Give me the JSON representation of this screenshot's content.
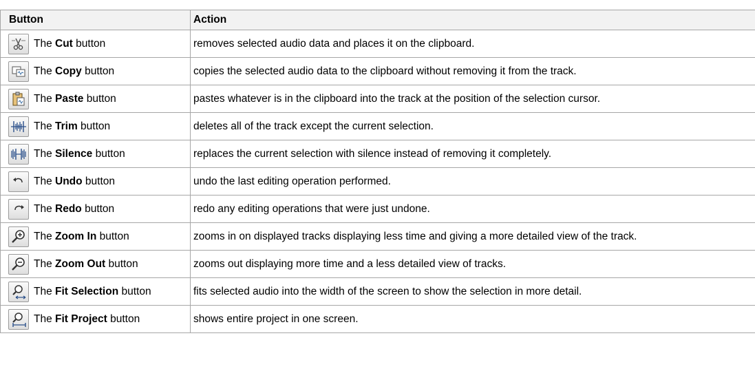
{
  "headers": {
    "button": "Button",
    "action": "Action"
  },
  "rows": [
    {
      "icon": "cut-icon",
      "prefix": "The ",
      "name": "Cut",
      "suffix": " button",
      "action": "removes selected audio data and places it on the clipboard."
    },
    {
      "icon": "copy-icon",
      "prefix": "The ",
      "name": "Copy",
      "suffix": " button",
      "action": "copies the selected audio data to the clipboard without removing it from the track."
    },
    {
      "icon": "paste-icon",
      "prefix": "The ",
      "name": "Paste",
      "suffix": " button",
      "action": "pastes whatever is in the clipboard into the track at the position of the selection cursor."
    },
    {
      "icon": "trim-icon",
      "prefix": "The ",
      "name": "Trim",
      "suffix": " button",
      "action": "deletes all of the track except the current selection."
    },
    {
      "icon": "silence-icon",
      "prefix": "The ",
      "name": "Silence",
      "suffix": " button",
      "action": "replaces the current selection with silence instead of removing it completely."
    },
    {
      "icon": "undo-icon",
      "prefix": "The ",
      "name": "Undo",
      "suffix": " button",
      "action": "undo the last editing operation performed."
    },
    {
      "icon": "redo-icon",
      "prefix": "The ",
      "name": "Redo",
      "suffix": " button",
      "action": "redo any editing operations that were just undone."
    },
    {
      "icon": "zoom-in-icon",
      "prefix": "The ",
      "name": "Zoom In",
      "suffix": " button",
      "action": "zooms in on displayed tracks displaying less time and giving a more detailed view of the track."
    },
    {
      "icon": "zoom-out-icon",
      "prefix": "The ",
      "name": "Zoom Out",
      "suffix": " button",
      "action": "zooms out displaying more time and a less detailed view of tracks."
    },
    {
      "icon": "fit-selection-icon",
      "prefix": "The ",
      "name": "Fit Selection",
      "suffix": " button",
      "action": "fits selected audio into the width of the screen to show the selection in more detail."
    },
    {
      "icon": "fit-project-icon",
      "prefix": "The ",
      "name": "Fit Project",
      "suffix": " button",
      "action": "shows entire project in one screen."
    }
  ]
}
